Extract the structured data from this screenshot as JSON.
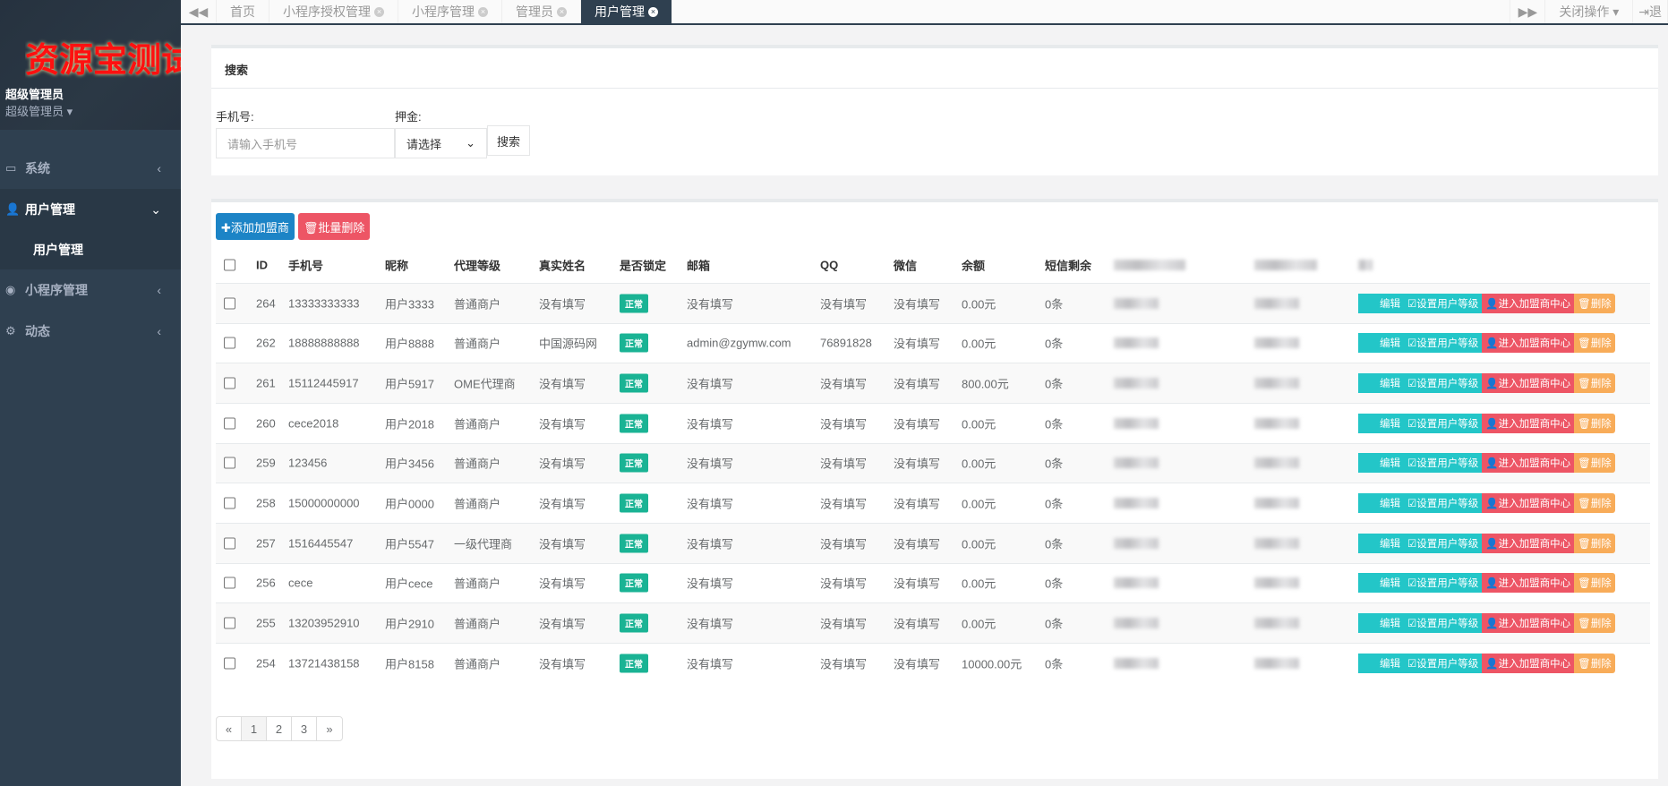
{
  "sidebar": {
    "logo": "资源宝测试",
    "user_name": "超级管理员",
    "user_role": "超级管理员 ▾",
    "items": [
      {
        "label": "系统",
        "icon": "desktop-icon"
      },
      {
        "label": "用户管理",
        "icon": "user-icon"
      },
      {
        "label": "小程序管理",
        "icon": "wechat-icon"
      },
      {
        "label": "动态",
        "icon": "gears-icon"
      }
    ],
    "sub_item": "用户管理"
  },
  "tabs": [
    {
      "label": "首页"
    },
    {
      "label": "小程序授权管理"
    },
    {
      "label": "小程序管理"
    },
    {
      "label": "管理员"
    },
    {
      "label": "用户管理",
      "active": true
    }
  ],
  "topbar": {
    "close_ops": "关闭操作 ▾",
    "logout": "退"
  },
  "search": {
    "title": "搜索",
    "phone_label": "手机号:",
    "phone_placeholder": "请输入手机号",
    "deposit_label": "押金:",
    "deposit_value": "请选择",
    "search_button": "搜索"
  },
  "toolbar": {
    "add": "✚添加加盟商",
    "batch_delete": "🗑批量删除"
  },
  "table": {
    "headers": [
      "ID",
      "手机号",
      "昵称",
      "代理等级",
      "真实姓名",
      "是否锁定",
      "邮箱",
      "QQ",
      "微信",
      "余额",
      "短信剩余"
    ],
    "rows": [
      [
        "264",
        "13333333333",
        "用户3333",
        "普通商户",
        "没有填写",
        "正常",
        "没有填写",
        "没有填写",
        "没有填写",
        "0.00元",
        "0条"
      ],
      [
        "262",
        "18888888888",
        "用户8888",
        "普通商户",
        "中国源码网",
        "正常",
        "admin@zgymw.com",
        "76891828",
        "没有填写",
        "0.00元",
        "0条"
      ],
      [
        "261",
        "15112445917",
        "用户5917",
        "OME代理商",
        "没有填写",
        "正常",
        "没有填写",
        "没有填写",
        "没有填写",
        "800.00元",
        "0条"
      ],
      [
        "260",
        "cece2018",
        "用户2018",
        "普通商户",
        "没有填写",
        "正常",
        "没有填写",
        "没有填写",
        "没有填写",
        "0.00元",
        "0条"
      ],
      [
        "259",
        "123456",
        "用户3456",
        "普通商户",
        "没有填写",
        "正常",
        "没有填写",
        "没有填写",
        "没有填写",
        "0.00元",
        "0条"
      ],
      [
        "258",
        "15000000000",
        "用户0000",
        "普通商户",
        "没有填写",
        "正常",
        "没有填写",
        "没有填写",
        "没有填写",
        "0.00元",
        "0条"
      ],
      [
        "257",
        "1516445547",
        "用户5547",
        "一级代理商",
        "没有填写",
        "正常",
        "没有填写",
        "没有填写",
        "没有填写",
        "0.00元",
        "0条"
      ],
      [
        "256",
        "cece",
        "用户cece",
        "普通商户",
        "没有填写",
        "正常",
        "没有填写",
        "没有填写",
        "没有填写",
        "0.00元",
        "0条"
      ],
      [
        "255",
        "13203952910",
        "用户2910",
        "普通商户",
        "没有填写",
        "正常",
        "没有填写",
        "没有填写",
        "没有填写",
        "0.00元",
        "0条"
      ],
      [
        "254",
        "13721438158",
        "用户8158",
        "普通商户",
        "没有填写",
        "正常",
        "没有填写",
        "没有填写",
        "没有填写",
        "10000.00元",
        "0条"
      ]
    ],
    "actions": [
      "编辑",
      "☑设置用户等级",
      "👤进入加盟商中心",
      "🗑删除"
    ]
  },
  "pagination": [
    "«",
    "1",
    "2",
    "3",
    "»"
  ]
}
